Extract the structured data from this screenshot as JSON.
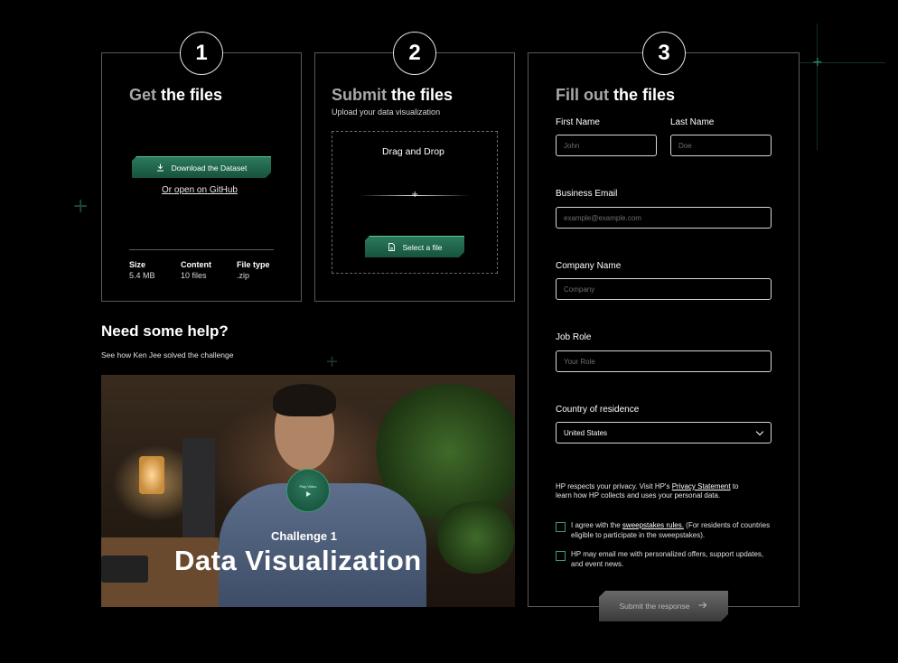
{
  "steps": {
    "get": {
      "number": "1",
      "title_muted": "Get",
      "title_rest": "the files",
      "download_label": "Download the Dataset",
      "github_link": "Or open on GitHub",
      "meta": [
        {
          "label": "Size",
          "value": "5.4 MB"
        },
        {
          "label": "Content",
          "value": "10 files"
        },
        {
          "label": "File type",
          "value": ".zip"
        }
      ]
    },
    "submit": {
      "number": "2",
      "title_muted": "Submit",
      "title_rest": "the files",
      "subtitle": "Upload your data visualization",
      "dropzone_title": "Drag and Drop",
      "select_label": "Select a file"
    },
    "fill": {
      "number": "3",
      "title_muted": "Fill out",
      "title_rest": "the files"
    }
  },
  "form": {
    "first_name": {
      "label": "First Name",
      "placeholder": "John"
    },
    "last_name": {
      "label": "Last Name",
      "placeholder": "Doe"
    },
    "email": {
      "label": "Business Email",
      "placeholder": "example@example.com"
    },
    "company": {
      "label": "Company Name",
      "placeholder": "Company"
    },
    "job_role": {
      "label": "Job Role",
      "placeholder": "Your Role"
    },
    "country": {
      "label": "Country of residence",
      "value": "United States"
    },
    "privacy": {
      "pre": "HP respects your privacy. Visit HP's ",
      "link": "Privacy Statement",
      "post": " to learn how HP collects and uses your personal data."
    },
    "consent_sweepstakes": {
      "pre": "I agree with the ",
      "link": "sweepstakes rules.",
      "post": " (For residents of countries eligible to participate in the sweepstakes)."
    },
    "consent_email": "HP may email me with personalized offers, support updates, and event news.",
    "submit_label": "Submit the response"
  },
  "help": {
    "title": "Need some help?",
    "subtitle": "See how Ken Jee solved the challenge",
    "video": {
      "play_label": "Play Video",
      "kicker": "Challenge 1",
      "headline": "Data Visualization"
    }
  },
  "colors": {
    "accent_green": "#2c7a5b",
    "border": "#5a5a5a",
    "background": "#000000"
  },
  "icons": {
    "download": "download-icon",
    "file": "file-icon",
    "play": "play-icon",
    "arrow": "arrow-right-icon",
    "chevron": "chevron-down-icon"
  }
}
